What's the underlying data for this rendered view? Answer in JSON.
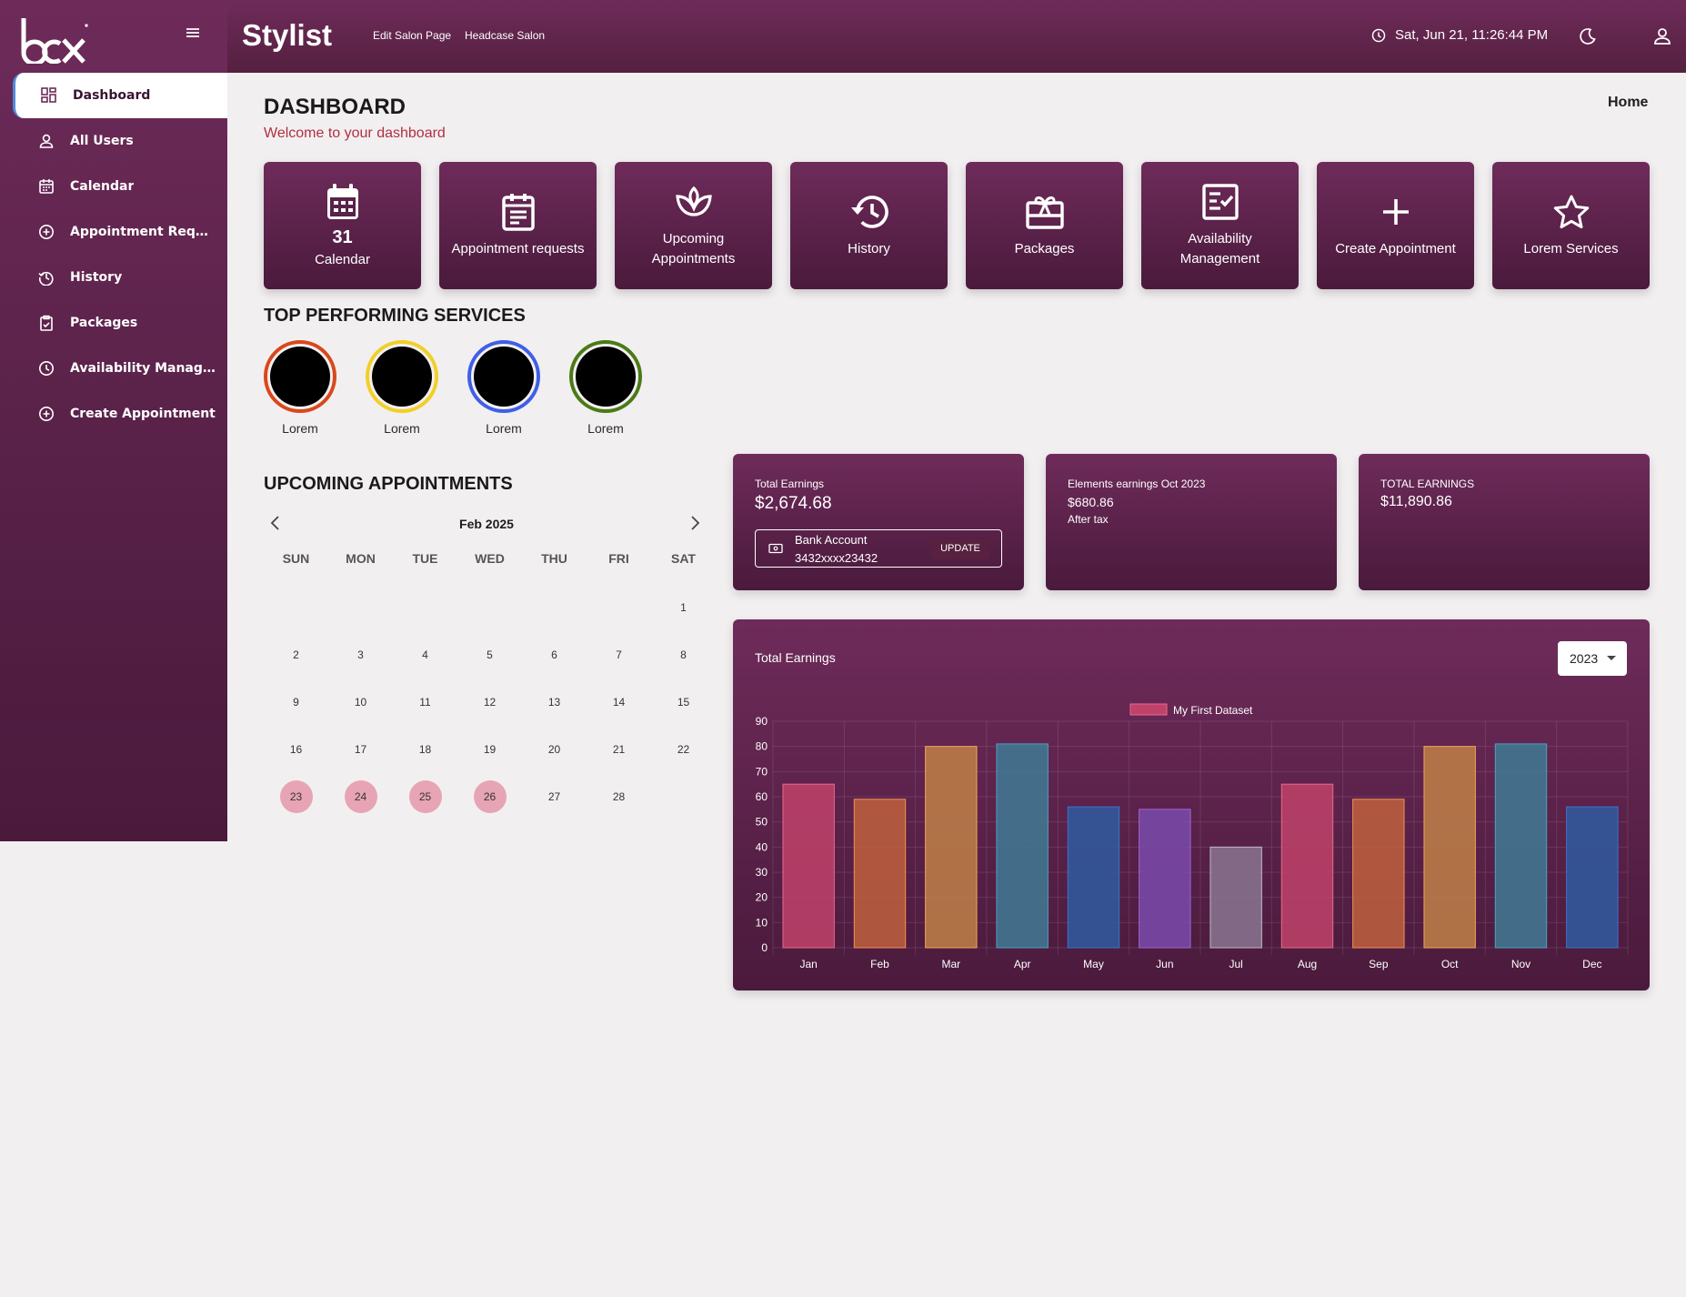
{
  "sidebar": {
    "items": [
      {
        "label": "Dashboard",
        "icon": "dashboard-icon",
        "active": true
      },
      {
        "label": "All Users",
        "icon": "user-icon"
      },
      {
        "label": "Calendar",
        "icon": "calendar-icon"
      },
      {
        "label": "Appointment Reque...",
        "icon": "plus-circle-icon"
      },
      {
        "label": "History",
        "icon": "history-icon"
      },
      {
        "label": "Packages",
        "icon": "clipboard-check-icon"
      },
      {
        "label": "Availability Manag...",
        "icon": "clock-icon"
      },
      {
        "label": "Create Appointment",
        "icon": "plus-circle-icon"
      }
    ]
  },
  "header": {
    "title": "Stylist",
    "links": [
      "Edit Salon Page",
      "Headcase Salon"
    ],
    "datetime": "Sat, Jun 21, 11:26:44 PM"
  },
  "page": {
    "title": "DASHBOARD",
    "subtitle": "Welcome to your dashboard",
    "breadcrumb": "Home"
  },
  "tiles": [
    {
      "number": "31",
      "label": "Calendar",
      "icon": "calendar-icon"
    },
    {
      "label": "Appointment requests",
      "icon": "clipboard-list-icon"
    },
    {
      "label": "Upcoming Appointments",
      "icon": "spa-icon"
    },
    {
      "label": "History",
      "icon": "history-icon"
    },
    {
      "label": "Packages",
      "icon": "gift-card-icon"
    },
    {
      "label": "Availability Management",
      "icon": "checklist-icon"
    },
    {
      "label": "Create Appointment",
      "icon": "plus-icon"
    },
    {
      "label": "Lorem Services",
      "icon": "star-icon"
    }
  ],
  "top_services": {
    "title": "TOP PERFORMING SERVICES",
    "items": [
      {
        "label": "Lorem",
        "color": "#d9481c"
      },
      {
        "label": "Lorem",
        "color": "#f2cf27"
      },
      {
        "label": "Lorem",
        "color": "#3e5fe6"
      },
      {
        "label": "Lorem",
        "color": "#4b7a16"
      }
    ]
  },
  "calendar": {
    "title": "UPCOMING APPOINTMENTS",
    "month": "Feb 2025",
    "weekdays": [
      "SUN",
      "MON",
      "TUE",
      "WED",
      "THU",
      "FRI",
      "SAT"
    ],
    "leading_blanks": 6,
    "days": [
      "1",
      "2",
      "3",
      "4",
      "5",
      "6",
      "7",
      "8",
      "9",
      "10",
      "11",
      "12",
      "13",
      "14",
      "15",
      "16",
      "17",
      "18",
      "19",
      "20",
      "21",
      "22",
      "23",
      "24",
      "25",
      "26",
      "27",
      "28"
    ],
    "marked_days": [
      "23",
      "24",
      "25",
      "26"
    ]
  },
  "earnings_cards": [
    {
      "label": "Total Earnings",
      "value": "$2,674.68",
      "bank": {
        "title": "Bank Account",
        "number": "3432xxxx23432",
        "button": "UPDATE"
      }
    },
    {
      "label": "Elements earnings Oct 2023",
      "value": "$680.86",
      "note": "After tax"
    },
    {
      "label": "TOTAL EARNINGS",
      "value": "$11,890.86"
    }
  ],
  "chart_panel": {
    "title": "Total Earnings",
    "year": "2023"
  },
  "chart_data": {
    "type": "bar",
    "categories": [
      "Jan",
      "Feb",
      "Mar",
      "Apr",
      "May",
      "Jun",
      "Jul",
      "Aug",
      "Sep",
      "Oct",
      "Nov",
      "Dec"
    ],
    "series": [
      {
        "name": "My First Dataset",
        "values": [
          65,
          59,
          80,
          81,
          56,
          55,
          40,
          65,
          59,
          80,
          81,
          56
        ]
      }
    ],
    "colors": [
      "#c0426a",
      "#c0603e",
      "#c08048",
      "#3f7a94",
      "#2f5aa0",
      "#7a4aac",
      "#8a7690",
      "#c0426a",
      "#c0603e",
      "#c08048",
      "#3f7a94",
      "#2f5aa0"
    ],
    "border_colors": [
      "#e56b8a",
      "#f29155",
      "#f2a657",
      "#4fa0c0",
      "#3d73c9",
      "#9b66d4",
      "#c2b8c6",
      "#e56b8a",
      "#f29155",
      "#f2a657",
      "#4fa0c0",
      "#3d73c9"
    ],
    "yticks": [
      0,
      10,
      20,
      30,
      40,
      50,
      60,
      70,
      80,
      90
    ],
    "ylim": [
      0,
      90
    ],
    "grid": true,
    "legend": "top"
  }
}
